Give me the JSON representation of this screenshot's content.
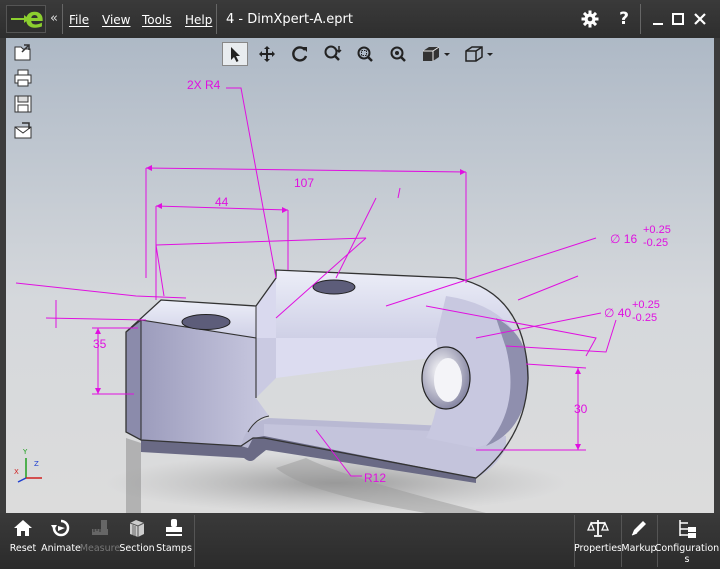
{
  "app": {
    "collapse_glyph": "«",
    "document_title": "4 - DimXpert-A.eprt"
  },
  "menu": [
    {
      "label": "File"
    },
    {
      "label": "View"
    },
    {
      "label": "Tools"
    },
    {
      "label": "Help"
    }
  ],
  "titlebar_icons": [
    "gear-icon",
    "help-icon",
    "minimize-icon",
    "maximize-icon",
    "close-icon"
  ],
  "help_glyph": "?",
  "view_toolbar": [
    "select-icon",
    "pan-icon",
    "rotate-icon",
    "zoom-icon",
    "zoom-to-area-icon",
    "zoom-to-fit-icon",
    "shaded-view-icon",
    "standard-views-icon"
  ],
  "side_toolbar": [
    "open-icon",
    "print-icon",
    "save-icon",
    "send-email-icon"
  ],
  "annotations": {
    "hole_r4": "2X R4",
    "width_107": "107",
    "width_44": "44",
    "diam_16": "∅  16",
    "diam_16_plus": "+0.25",
    "diam_16_minus": "-0.25",
    "diam_40": "∅ 40",
    "diam_40_plus": "+0.25",
    "diam_40_minus": "-0.25",
    "height_35": "35",
    "height_30": "30",
    "radius_r12": "R12"
  },
  "triad": {
    "x": "X",
    "y": "Y",
    "z": "Z"
  },
  "bottom_left": [
    {
      "label": "Reset",
      "icon": "home-icon",
      "enabled": true
    },
    {
      "label": "Animate",
      "icon": "animate-icon",
      "enabled": true
    },
    {
      "label": "Measure",
      "icon": "measure-icon",
      "enabled": false
    },
    {
      "label": "Section",
      "icon": "section-icon",
      "enabled": true
    },
    {
      "label": "Stamps",
      "icon": "stamps-icon",
      "enabled": true
    }
  ],
  "bottom_right": [
    {
      "label": "Properties",
      "icon": "properties-icon"
    },
    {
      "label": "Markup",
      "icon": "markup-icon"
    },
    {
      "label": "Configurations",
      "label_line1": "Configuration",
      "label_line2": "s",
      "icon": "configurations-icon"
    }
  ],
  "colors": {
    "annotation": "#e010e0",
    "part_face": "#d8d8ec",
    "brand_green": "#8ccf2f"
  }
}
